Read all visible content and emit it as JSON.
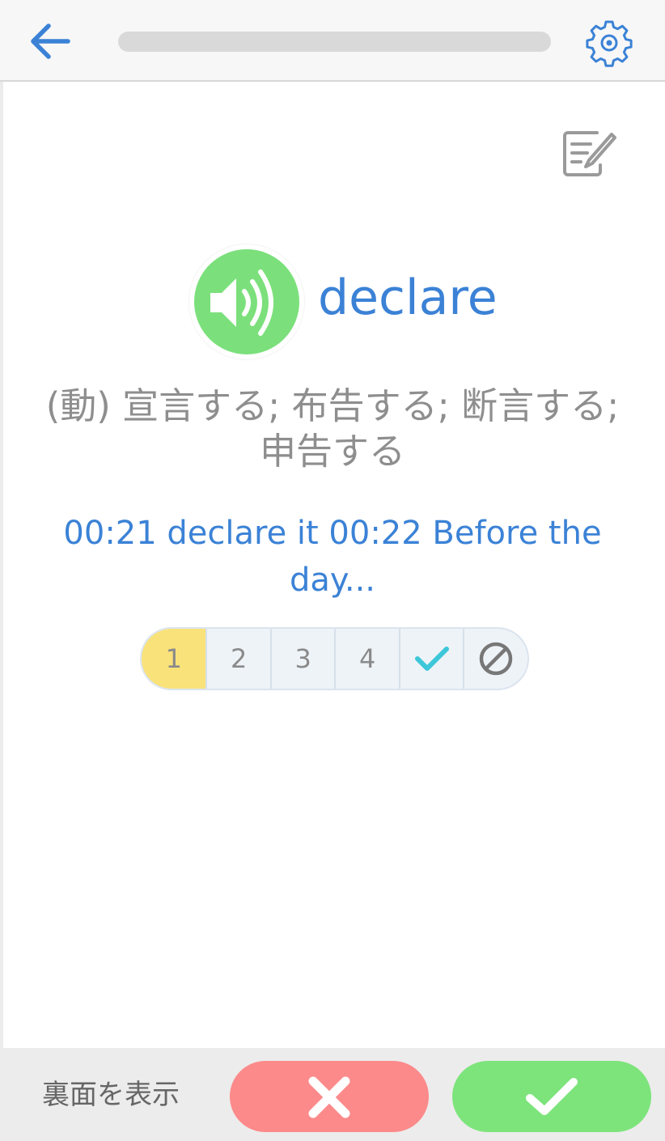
{
  "header": {
    "back_icon": "arrow-left-icon",
    "settings_icon": "gear-icon",
    "progress": 0.0,
    "accent_color": "#3b82d6"
  },
  "card": {
    "edit_icon": "edit-note-icon",
    "speaker_icon": "speaker-icon",
    "word": "declare",
    "meaning": "(動) 宣言する; 布告する; 断言する; 申告する",
    "example": "00:21 declare it 00:22 Before the day..."
  },
  "rating": {
    "items": [
      "1",
      "2",
      "3",
      "4"
    ],
    "selected": "1",
    "check_icon": "checkmark-icon",
    "block_icon": "prohibit-icon",
    "selected_color": "#f9e27a"
  },
  "footer": {
    "show_back_label": "裏面を表示",
    "wrong_icon": "x-icon",
    "right_icon": "checkmark-icon",
    "wrong_color": "#fc8a8a",
    "right_color": "#7de47c"
  }
}
